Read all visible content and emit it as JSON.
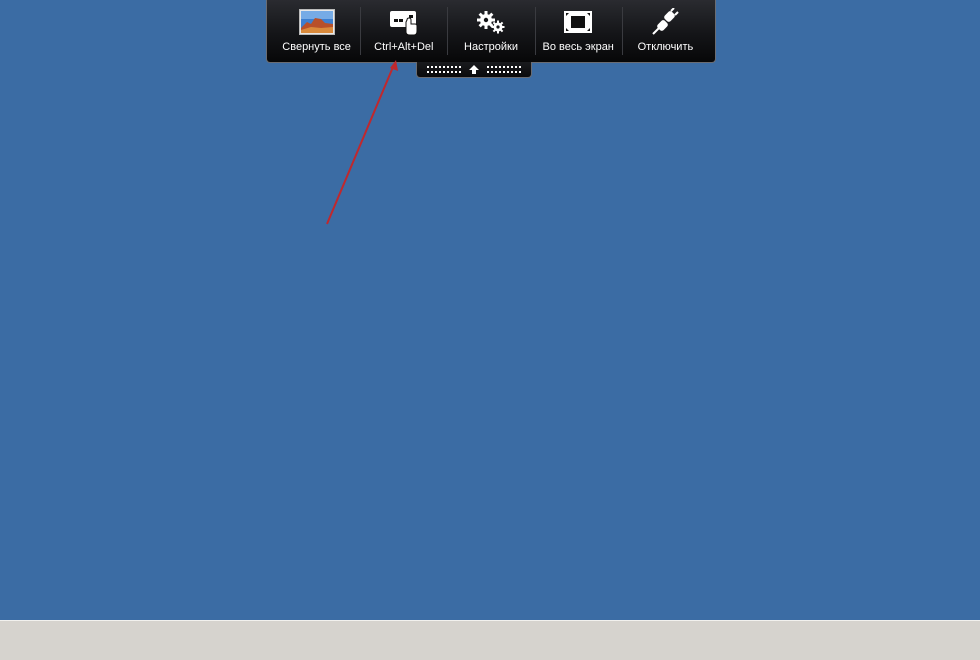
{
  "toolbar": {
    "buttons": [
      {
        "label": "Свернуть все",
        "icon": "desert-wallpaper-icon"
      },
      {
        "label": "Ctrl+Alt+Del",
        "icon": "keyboard-hand-icon"
      },
      {
        "label": "Настройки",
        "icon": "gears-icon"
      },
      {
        "label": "Во весь экран",
        "icon": "fullscreen-icon"
      },
      {
        "label": "Отключить",
        "icon": "plug-icon"
      }
    ],
    "handle_icon": "up-arrow-icon"
  },
  "colors": {
    "desktop": "#3b6ca4",
    "taskbar": "#d6d3ce",
    "toolbar": "#141518",
    "annotation_arrow": "#c0282d"
  }
}
